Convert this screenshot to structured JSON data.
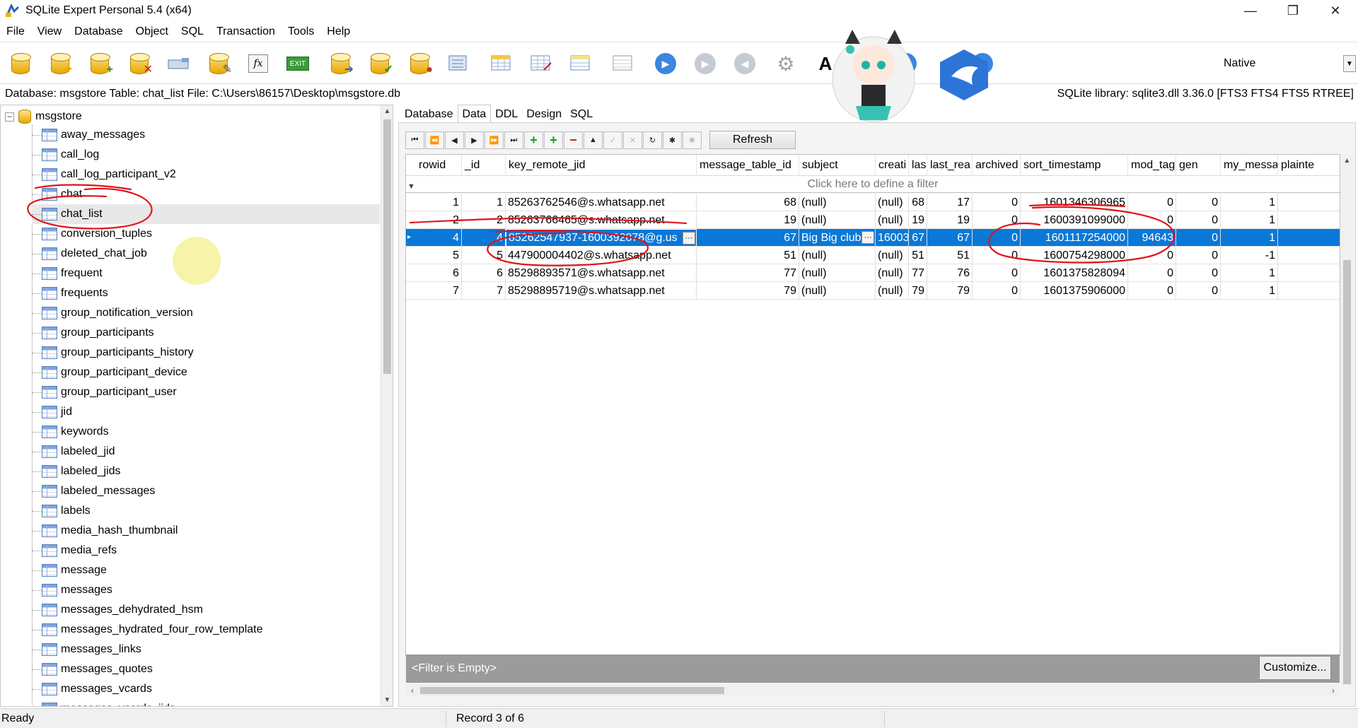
{
  "window": {
    "title": "SQLite Expert Personal 5.4 (x64)",
    "minimize": "—",
    "maximize": "❐",
    "close": "✕"
  },
  "menu": [
    "File",
    "View",
    "Database",
    "Object",
    "SQL",
    "Transaction",
    "Tools",
    "Help"
  ],
  "toolbar": {
    "buttons": [
      "open-database-icon",
      "new-database-icon",
      "attach-database-icon",
      "detach-database-icon",
      "new-table-icon",
      "edit-database-icon",
      "function-icon",
      "exit-icon",
      "import-icon",
      "vacuum-icon",
      "users-icon",
      "compare-icon",
      "new-view-icon",
      "edit-view-icon",
      "add-view-icon",
      "report-icon",
      "run-icon",
      "stop-icon",
      "back-icon",
      "settings-icon",
      "font-icon",
      "refresh-icon",
      "info-icon"
    ],
    "native_label": "Native",
    "exit_label": "EXIT",
    "fx_label": "fx",
    "font_label": "A"
  },
  "info_bar": {
    "database_info": "Database: msgstore   Table: chat_list   File: C:\\Users\\86157\\Desktop\\msgstore.db",
    "library_info": "SQLite library: sqlite3.dll 3.36.0 [FTS3 FTS4 FTS5 RTREE]"
  },
  "tree": {
    "root": "msgstore",
    "expander": "−",
    "items": [
      {
        "label": "away_messages"
      },
      {
        "label": "call_log"
      },
      {
        "label": "call_log_participant_v2"
      },
      {
        "label": "chat"
      },
      {
        "label": "chat_list"
      },
      {
        "label": "conversion_tuples"
      },
      {
        "label": "deleted_chat_job"
      },
      {
        "label": "frequent"
      },
      {
        "label": "frequents"
      },
      {
        "label": "group_notification_version"
      },
      {
        "label": "group_participants"
      },
      {
        "label": "group_participants_history"
      },
      {
        "label": "group_participant_device"
      },
      {
        "label": "group_participant_user"
      },
      {
        "label": "jid"
      },
      {
        "label": "keywords"
      },
      {
        "label": "labeled_jid"
      },
      {
        "label": "labeled_jids"
      },
      {
        "label": "labeled_messages"
      },
      {
        "label": "labels"
      },
      {
        "label": "media_hash_thumbnail"
      },
      {
        "label": "media_refs"
      },
      {
        "label": "message"
      },
      {
        "label": "messages"
      },
      {
        "label": "messages_dehydrated_hsm"
      },
      {
        "label": "messages_hydrated_four_row_template"
      },
      {
        "label": "messages_links"
      },
      {
        "label": "messages_quotes"
      },
      {
        "label": "messages_vcards"
      },
      {
        "label": "messages_vcards_jids"
      }
    ],
    "selected_index": 4
  },
  "tabs": [
    "Database",
    "Data",
    "DDL",
    "Design",
    "SQL"
  ],
  "active_tab": "Data",
  "navigator": {
    "first": "⏮",
    "prev_page": "⏪",
    "prev": "◀",
    "next": "▶",
    "next_page": "⏩",
    "last": "⏭",
    "insert": "+",
    "append": "+",
    "delete": "−",
    "edit": "▲",
    "post": "✓",
    "cancel": "✕",
    "refresh_small": "↻",
    "bookmark": "✱",
    "clear": "✱",
    "refresh_label": "Refresh"
  },
  "grid": {
    "columns": [
      "rowid",
      "_id",
      "key_remote_jid",
      "message_table_id",
      "subject",
      "creati",
      "las",
      "last_rea",
      "archived",
      "sort_timestamp",
      "mod_tag",
      "gen",
      "my_messages",
      "plainte"
    ],
    "filter_prompt": "Click here to define a filter",
    "rows": [
      [
        "1",
        "1",
        "85263762546@s.whatsapp.net",
        "68",
        "(null)",
        "(null)",
        "68",
        "17",
        "0",
        "1601346306965",
        "0",
        "0",
        "1",
        ""
      ],
      [
        "2",
        "2",
        "85263766465@s.whatsapp.net",
        "19",
        "(null)",
        "(null)",
        "19",
        "19",
        "0",
        "1600391099000",
        "0",
        "0",
        "1",
        ""
      ],
      [
        "4",
        "4",
        "85262547937-1600392878@g.us",
        "67",
        "Big Big club",
        "16003",
        "67",
        "67",
        "0",
        "1601117254000",
        "94643",
        "0",
        "1",
        ""
      ],
      [
        "5",
        "5",
        "447900004402@s.whatsapp.net",
        "51",
        "(null)",
        "(null)",
        "51",
        "51",
        "0",
        "1600754298000",
        "0",
        "0",
        "-1",
        ""
      ],
      [
        "6",
        "6",
        "85298893571@s.whatsapp.net",
        "77",
        "(null)",
        "(null)",
        "77",
        "76",
        "0",
        "1601375828094",
        "0",
        "0",
        "1",
        ""
      ],
      [
        "7",
        "7",
        "85298895719@s.whatsapp.net",
        "79",
        "(null)",
        "(null)",
        "79",
        "79",
        "0",
        "1601375906000",
        "0",
        "0",
        "1",
        ""
      ]
    ],
    "selected_row": 2,
    "ellipsis": "···",
    "filter_status": "<Filter is Empty>",
    "customize_label": "Customize..."
  },
  "status": {
    "state": "Ready",
    "record": "Record 3 of 6"
  },
  "colors": {
    "selection": "#0a78d7",
    "annotation": "#e0141b",
    "highlight_circle": "#f5f29a"
  }
}
